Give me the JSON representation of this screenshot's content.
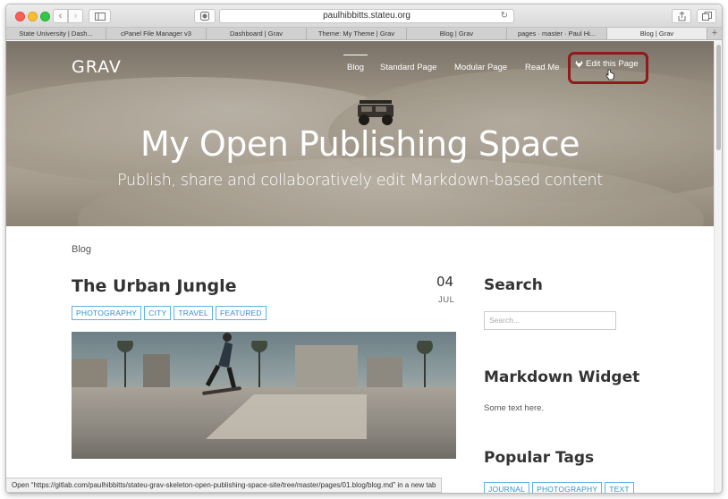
{
  "browser": {
    "url": "paulhibbitts.stateu.org",
    "tabs": [
      {
        "label": "State University | Dash..."
      },
      {
        "label": "cPanel File Manager v3"
      },
      {
        "label": "Dashboard | Grav"
      },
      {
        "label": "Theme: My Theme | Grav"
      },
      {
        "label": "Blog | Grav"
      },
      {
        "label": "pages · master · Paul Hi..."
      },
      {
        "label": "Blog | Grav"
      }
    ],
    "active_tab_index": 6,
    "status": "Open “https://gitlab.com/paulhibbitts/stateu-grav-skeleton-open-publishing-space-site/tree/master/pages/01.blog/blog.md” in a new tab"
  },
  "site": {
    "logo": "GRAV",
    "nav": [
      {
        "label": "Blog",
        "active": true
      },
      {
        "label": "Standard Page",
        "active": false
      },
      {
        "label": "Modular Page",
        "active": false
      },
      {
        "label": "Read Me",
        "active": false
      }
    ],
    "edit_link": "Edit this Page",
    "hero_title": "My Open Publishing Space",
    "hero_subtitle": "Publish, share and collaboratively edit Markdown-based content"
  },
  "content": {
    "breadcrumb": "Blog",
    "post": {
      "title": "The Urban Jungle",
      "day": "04",
      "month": "JUL",
      "tags": [
        "PHOTOGRAPHY",
        "CITY",
        "TRAVEL",
        "FEATURED"
      ]
    }
  },
  "sidebar": {
    "search_heading": "Search",
    "search_placeholder": "Search...",
    "markdown_heading": "Markdown Widget",
    "markdown_text": "Some text here.",
    "popular_heading": "Popular Tags",
    "popular_tags": [
      "JOURNAL",
      "PHOTOGRAPHY",
      "TEXT"
    ]
  },
  "colors": {
    "tag_border": "#5fb4e0",
    "tag_text": "#2a94c9",
    "highlight_box": "#8e1a1a"
  }
}
